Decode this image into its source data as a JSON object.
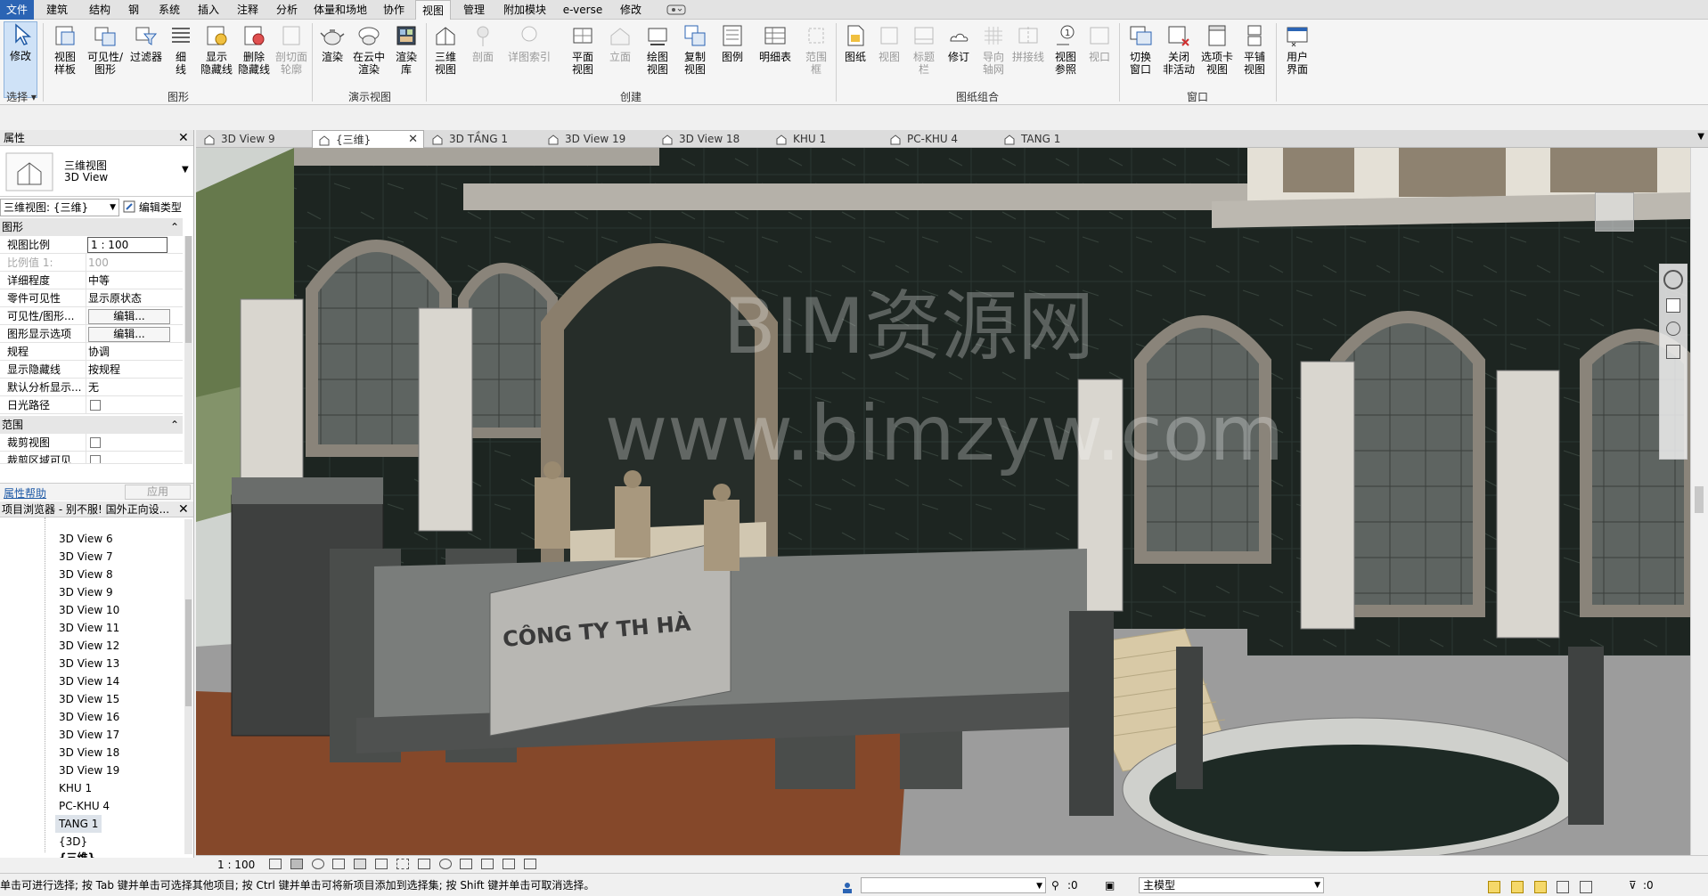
{
  "menu": {
    "items": [
      "文件",
      "建筑",
      "结构",
      "钢",
      "系统",
      "插入",
      "注释",
      "分析",
      "体量和场地",
      "协作",
      "视图",
      "管理",
      "附加模块",
      "e-verse",
      "修改"
    ],
    "active": "视图"
  },
  "ribbon": {
    "buttons": {
      "modify": "修改",
      "view_template": "视图\n样板",
      "visibility": "可见性/\n图形",
      "filters": "过滤器",
      "thin_lines": "细\n线",
      "show_hidden": "显示\n隐藏线",
      "remove_hidden": "删除\n隐藏线",
      "cut_profile": "剖切面\n轮廓",
      "render": "渲染",
      "render_cloud": "在云中\n渲染",
      "render_gallery": "渲染\n库",
      "view_3d": "三维\n视图",
      "section": "剖面",
      "callout": "详图索引",
      "plan_views": "平面\n视图",
      "elevation": "立面",
      "drafting": "绘图\n视图",
      "duplicate": "复制\n视图",
      "legends": "图例",
      "schedules": "明细表",
      "scope_box": "范围\n框",
      "sheet": "图纸",
      "view": "视图",
      "title_block": "标题\n栏",
      "revisions": "修订",
      "guide_grid": "导向\n轴网",
      "matchline": "拼接线",
      "view_reference": "视图\n参照",
      "viewports": "视口",
      "switch_windows": "切换\n窗口",
      "close_inactive": "关闭\n非活动",
      "tab_views": "选项卡\n视图",
      "tile_views": "平铺\n视图",
      "user_interface": "用户\n界面"
    },
    "groups": {
      "select": "选择",
      "graphics": "图形",
      "presentation": "演示视图",
      "create": "创建",
      "sheet_composition": "图纸组合",
      "windows": "窗口"
    }
  },
  "view_tabs": [
    {
      "label": "3D View 9",
      "active": false
    },
    {
      "label": "{三维}",
      "active": true
    },
    {
      "label": "3D TẦNG 1",
      "active": false
    },
    {
      "label": "3D View 19",
      "active": false
    },
    {
      "label": "3D View 18",
      "active": false
    },
    {
      "label": "KHU 1",
      "active": false
    },
    {
      "label": "PC-KHU 4",
      "active": false
    },
    {
      "label": "TANG 1",
      "active": false
    }
  ],
  "properties": {
    "title": "属性",
    "type_line1": "三维视图",
    "type_line2": "3D View",
    "selector": "三维视图: {三维}",
    "edit_type": "编辑类型",
    "section_graphics": "图形",
    "section_extents": "范围",
    "rows": [
      {
        "key": "视图比例",
        "value": "1 : 100"
      },
      {
        "key": "比例值 1:",
        "value": "100"
      },
      {
        "key": "详细程度",
        "value": "中等"
      },
      {
        "key": "零件可见性",
        "value": "显示原状态"
      },
      {
        "key": "可见性/图形...",
        "value": "编辑..."
      },
      {
        "key": "图形显示选项",
        "value": "编辑..."
      },
      {
        "key": "规程",
        "value": "协调"
      },
      {
        "key": "显示隐藏线",
        "value": "按规程"
      },
      {
        "key": "默认分析显示...",
        "value": "无"
      },
      {
        "key": "日光路径",
        "value": ""
      }
    ],
    "extents_rows": [
      {
        "key": "裁剪视图",
        "value": ""
      },
      {
        "key": "裁剪区域可见",
        "value": ""
      }
    ],
    "help_link": "属性帮助",
    "apply": "应用"
  },
  "browser": {
    "title": "项目浏览器 - 别不服! 国外正向设...",
    "items": [
      "3D View 6",
      "3D View 7",
      "3D View 8",
      "3D View 9",
      "3D View 10",
      "3D View 11",
      "3D View 12",
      "3D View 13",
      "3D View 14",
      "3D View 15",
      "3D View 16",
      "3D View 17",
      "3D View 18",
      "3D View 19",
      "KHU 1",
      "PC-KHU 4",
      "TANG 1",
      "{3D}",
      "{三维}"
    ],
    "selected": "TANG 1"
  },
  "viewport": {
    "watermark_line1": "BIM资源网",
    "watermark_line2": "www.bimzyw.com",
    "sign_text": "CÔNG TY TH   HÀ"
  },
  "view_status": {
    "scale": "1 : 100"
  },
  "statusbar": {
    "hint": "单击可进行选择; 按 Tab 键并单击可选择其他项目; 按 Ctrl 键并单击可将新项目添加到选择集; 按 Shift 键并单击可取消选择。",
    "count1": ":0",
    "model": "主模型",
    "count2": ":0"
  },
  "colors": {
    "accent": "#2b64b4",
    "marble": "#1e2622",
    "stone": "#b7b2a8",
    "ground": "#8a4a2a"
  }
}
